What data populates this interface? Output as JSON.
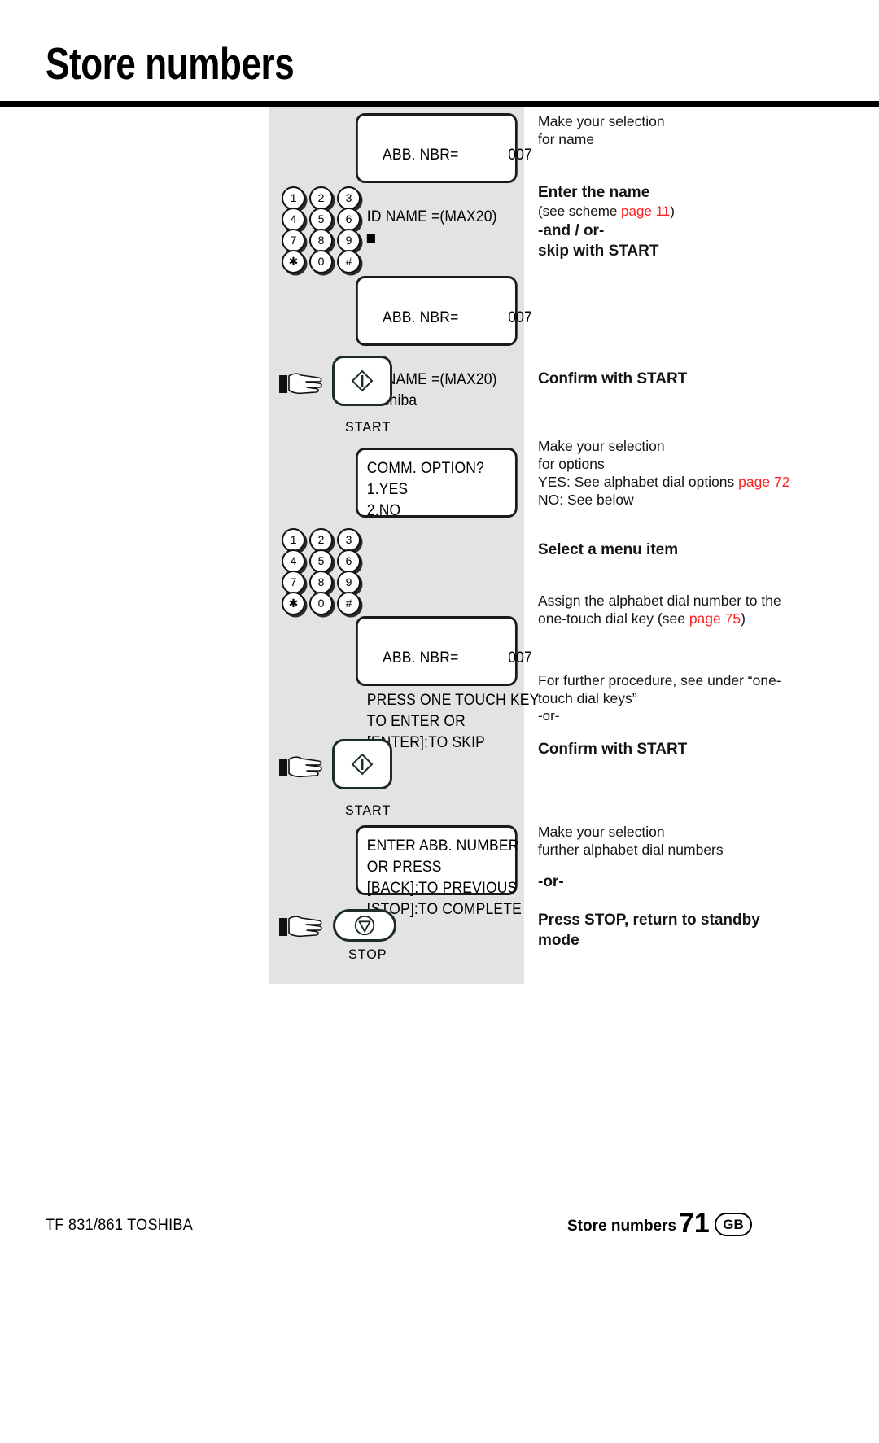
{
  "page": {
    "title": "Store numbers"
  },
  "displays": {
    "d1": {
      "line1_label": "ABB. NBR=",
      "line1_value": "007",
      "line2": "ID NAME =(MAX20)",
      "line3_cursor": "cursor-block"
    },
    "d2": {
      "line1_label": "ABB. NBR=",
      "line1_value": "007",
      "line2": "ID NAME =(MAX20)",
      "line3": "Toshiba"
    },
    "d3": {
      "line1": "COMM. OPTION?",
      "line2": "1.YES",
      "line3": "2.NO"
    },
    "d4": {
      "line1_label": "ABB. NBR=",
      "line1_value": "007",
      "line2": "PRESS ONE TOUCH KEY",
      "line3": "TO ENTER OR",
      "line4": "[ENTER]:TO SKIP"
    },
    "d5": {
      "line1": "ENTER ABB. NUMBER",
      "line2": "OR PRESS",
      "line3": "[BACK]:TO PREVIOUS",
      "line4": "[STOP]:TO COMPLETE"
    }
  },
  "keypad": {
    "rows": [
      [
        "1",
        "2",
        "3"
      ],
      [
        "4",
        "5",
        "6"
      ],
      [
        "7",
        "8",
        "9"
      ],
      [
        "✱",
        "0",
        "#"
      ]
    ]
  },
  "buttons": {
    "start_caption": "START",
    "stop_caption": "STOP"
  },
  "instructions": {
    "b1": {
      "l1": "Make your selection",
      "l2": "for  name"
    },
    "b2": {
      "heading": "Enter the name",
      "see_prefix": "(see scheme ",
      "see_link": "page 11",
      "see_suffix": ")",
      "andor": "-and / or-",
      "skip": "skip with START"
    },
    "b3": {
      "confirm": "Confirm with START"
    },
    "b4": {
      "l1": "Make your selection",
      "l2": "for options",
      "l3_prefix": "YES: See alphabet dial options ",
      "l3_link": "page 72",
      "l4": "NO: See below"
    },
    "b5": {
      "heading": "Select a menu item"
    },
    "b6": {
      "l1": "Assign the alphabet dial number to the",
      "l2_prefix": "one-touch dial key (see ",
      "l2_link": "page 75",
      "l2_suffix": ")"
    },
    "b7": {
      "l1": "For further procedure, see under “one-",
      "l2": "touch dial keys”",
      "l3": "-or-"
    },
    "b8": {
      "confirm": "Confirm with START"
    },
    "b9": {
      "l1": "Make your selection",
      "l2": "further alphabet dial numbers",
      "l3": "-or-"
    },
    "b10": {
      "l1": "Press STOP, return to standby",
      "l2": "mode"
    }
  },
  "footer": {
    "model": "TF 831/861 TOSHIBA",
    "chapter": "Store numbers",
    "page_number": "71",
    "language": "GB"
  }
}
